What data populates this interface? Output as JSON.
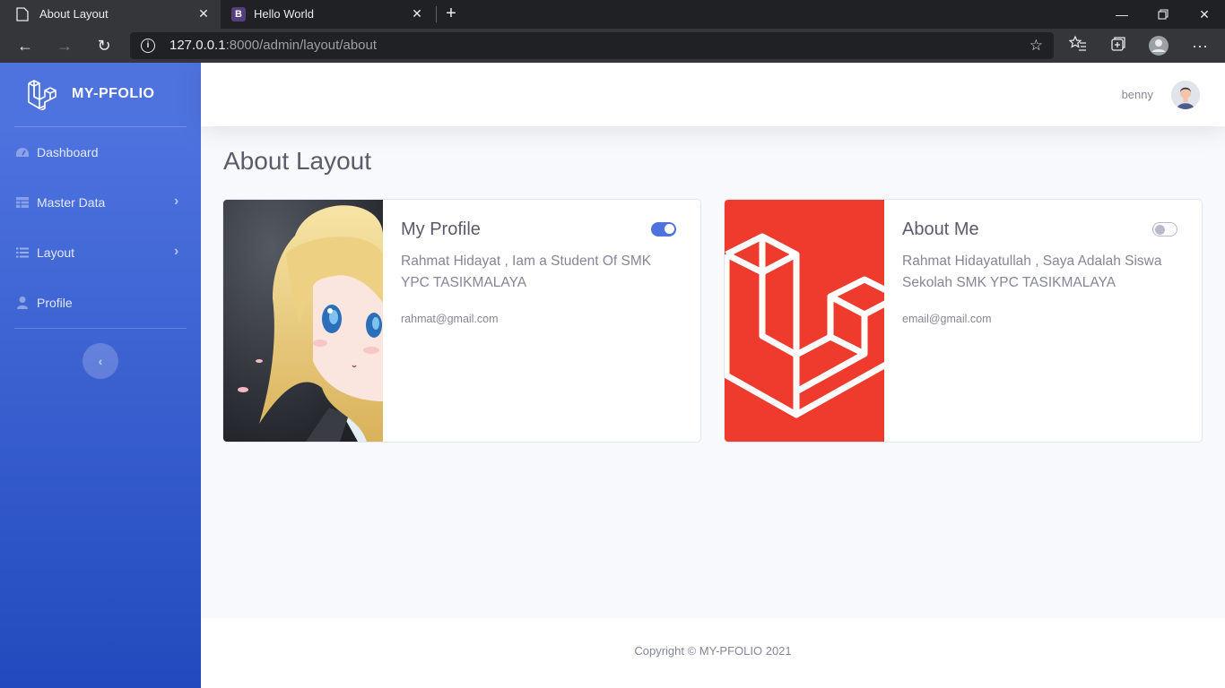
{
  "browser": {
    "tabs": [
      {
        "title": "About Layout",
        "active": true
      },
      {
        "title": "Hello World",
        "active": false,
        "favicon_letter": "B"
      }
    ],
    "url_host": "127.0.0.1",
    "url_rest": ":8000/admin/layout/about",
    "colors": {
      "chrome": "#202124",
      "chrome_active": "#35363a"
    }
  },
  "sidebar": {
    "brand": "MY-PFOLIO",
    "items": [
      {
        "label": "Dashboard",
        "icon": "tachometer-icon"
      },
      {
        "label": "Master Data",
        "icon": "table-icon",
        "has_submenu": true
      },
      {
        "label": "Layout",
        "icon": "list-icon",
        "has_submenu": true
      },
      {
        "label": "Profile",
        "icon": "user-icon"
      }
    ],
    "toggle_glyph": "‹",
    "chevron_glyph": "›"
  },
  "topbar": {
    "username": "benny"
  },
  "page": {
    "title": "About Layout"
  },
  "cards": [
    {
      "title": "My Profile",
      "text": "Rahmat Hidayat , Iam a Student Of SMK YPC TASIKMALAYA",
      "email": "rahmat@gmail.com",
      "toggle_on": true
    },
    {
      "title": "About Me",
      "text": "Rahmat Hidayatullah , Saya Adalah Siswa Sekolah SMK YPC TASIKMALAYA",
      "email": "email@gmail.com",
      "toggle_on": false
    }
  ],
  "footer": {
    "copyright": "Copyright © MY-PFOLIO 2021"
  },
  "colors": {
    "primary": "#4e73df",
    "laravel_red": "#ef3b2d",
    "text_muted": "#858796",
    "heading": "#5a5c69"
  }
}
